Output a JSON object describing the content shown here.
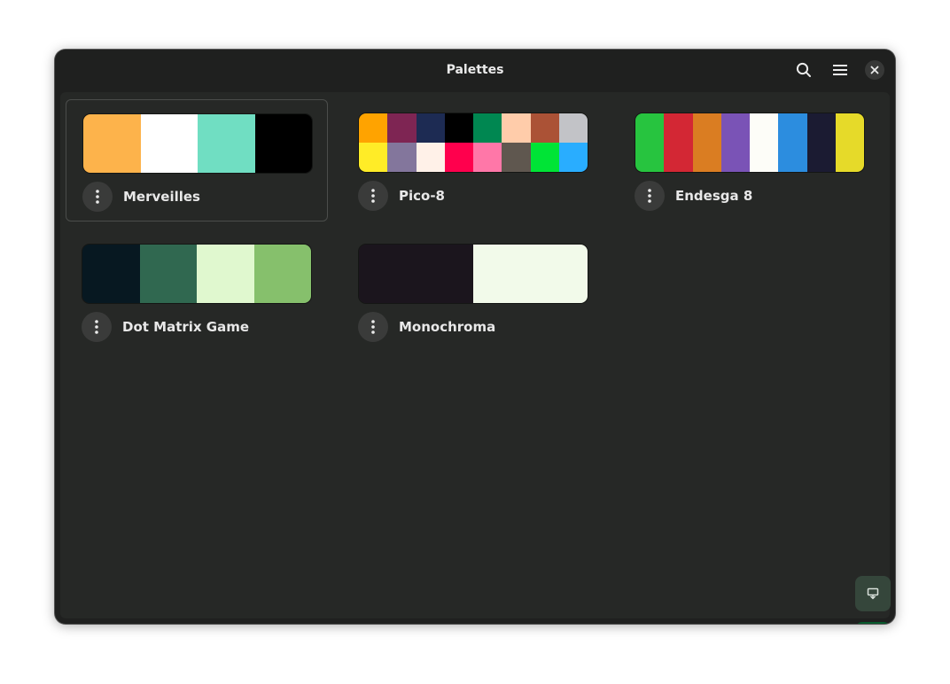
{
  "window": {
    "title": "Palettes"
  },
  "headerbar": {
    "icons": [
      "search-icon",
      "hamburger-menu-icon",
      "close-icon"
    ]
  },
  "palettes": [
    {
      "name": "Merveilles",
      "selected": true,
      "rows": 1,
      "colors": [
        "#fdb34b",
        "#ffffff",
        "#70dec2",
        "#000000"
      ]
    },
    {
      "name": "Pico-8",
      "selected": false,
      "rows": 2,
      "colors": [
        "#ffa300",
        "#7e2553",
        "#1d2b53",
        "#000000",
        "#008751",
        "#ffccaa",
        "#ab5236",
        "#c2c3c7",
        "#ffec27",
        "#83769c",
        "#fff1e8",
        "#ff004d",
        "#ff77a8",
        "#5f574f",
        "#00e436",
        "#29adff"
      ]
    },
    {
      "name": "Endesga 8",
      "selected": false,
      "rows": 1,
      "colors": [
        "#27c43f",
        "#d32734",
        "#da7d22",
        "#7a53b6",
        "#fdfdf8",
        "#2c8ddf",
        "#1b1b32",
        "#e6da29"
      ]
    },
    {
      "name": "Dot Matrix Game",
      "selected": false,
      "rows": 1,
      "colors": [
        "#071821",
        "#306850",
        "#e0f8cf",
        "#86c06c"
      ]
    },
    {
      "name": "Monochroma",
      "selected": false,
      "rows": 1,
      "colors": [
        "#1b151d",
        "#f2faea"
      ]
    }
  ],
  "buttons": {
    "secondary_fab_icon": "present-icon",
    "add_palette_icon": "plus-icon"
  },
  "theme": {
    "accent": "#075a2c",
    "window_bg": "#1f201f",
    "content_bg": "#262826"
  }
}
